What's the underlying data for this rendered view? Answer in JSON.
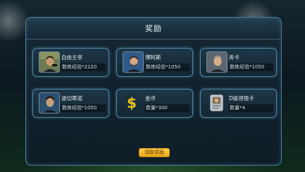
{
  "dialog": {
    "title": "奖励"
  },
  "rewards": [
    {
      "name": "自由主宰",
      "detail": "数练经验*2220",
      "icon": "player-portrait-icon"
    },
    {
      "name": "博阿斯",
      "detail": "数练经验*1050",
      "icon": "player-portrait-icon"
    },
    {
      "name": "库卡",
      "detail": "数练经验*1050",
      "icon": "player-portrait-icon"
    },
    {
      "name": "波切蒂诺",
      "detail": "数练经验*1050",
      "icon": "player-portrait-icon"
    },
    {
      "name": "金币",
      "detail": "数量*300",
      "icon": "dollar-icon",
      "icon_glyph": "$"
    },
    {
      "name": "D级领悟卡",
      "detail": "数量*4",
      "icon": "card-icon"
    }
  ],
  "actions": {
    "claim_label": "领取奖励"
  },
  "colors": {
    "accent": "#4f86a6",
    "gold": "#f0c419",
    "button": "#e8a317"
  }
}
